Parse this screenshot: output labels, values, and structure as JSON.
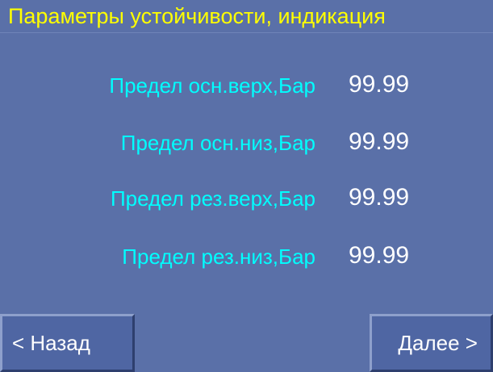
{
  "header": {
    "title": "Параметры устойчивости, индикация"
  },
  "params": [
    {
      "label": "Предел осн.верх,Бар",
      "value": "99.99"
    },
    {
      "label": "Предел осн.низ,Бар",
      "value": "99.99"
    },
    {
      "label": "Предел рез.верх,Бар",
      "value": "99.99"
    },
    {
      "label": "Предел рез.низ,Бар",
      "value": "99.99"
    }
  ],
  "nav": {
    "back_label": "< Назад",
    "next_label": "Далее >"
  },
  "colors": {
    "background": "#5a70a8",
    "title": "#ffff00",
    "label": "#00ffff",
    "value": "#ffffff"
  }
}
